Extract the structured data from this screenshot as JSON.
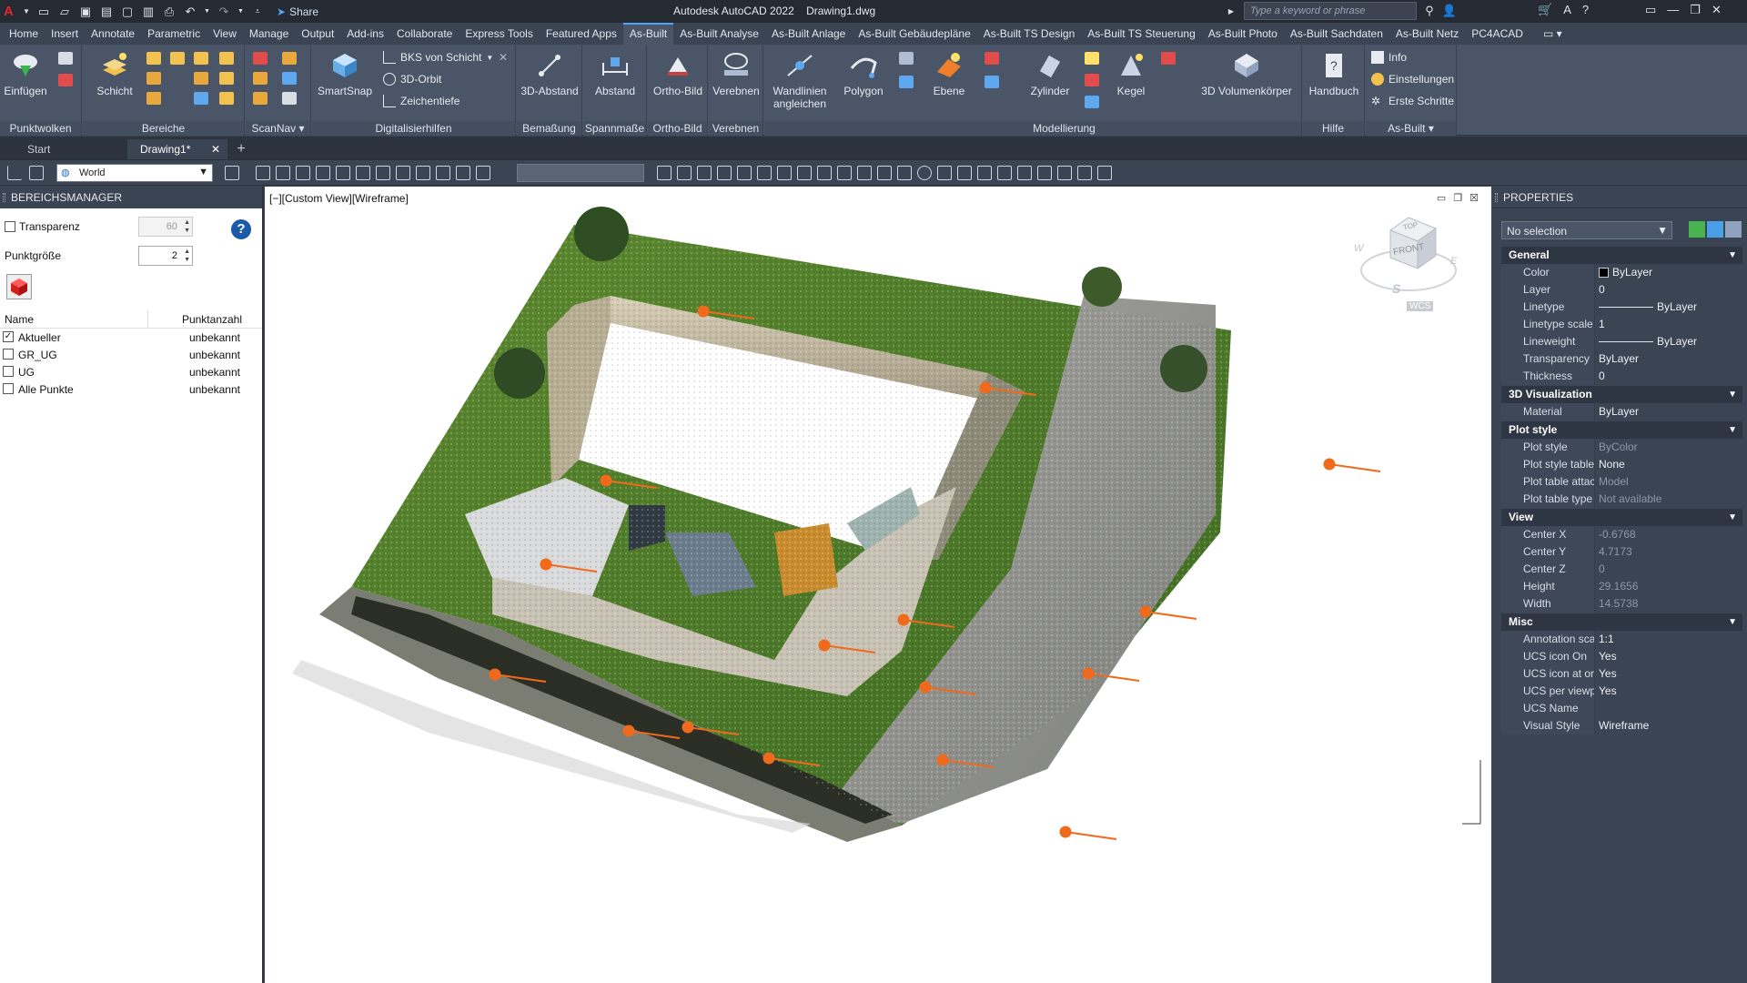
{
  "titlebar": {
    "title": "Autodesk AutoCAD 2022    Drawing1.dwg",
    "share": "Share",
    "search_placeholder": "Type a keyword or phrase"
  },
  "ribbon_tabs": [
    "Home",
    "Insert",
    "Annotate",
    "Parametric",
    "View",
    "Manage",
    "Output",
    "Add-ins",
    "Collaborate",
    "Express Tools",
    "Featured Apps",
    "As-Built",
    "As-Built Analyse",
    "As-Built Anlage",
    "As-Built Gebäudepläne",
    "As-Built TS Design",
    "As-Built TS Steuerung",
    "As-Built Photo",
    "As-Built Sachdaten",
    "As-Built Netz",
    "PC4ACAD"
  ],
  "active_tab": "As-Built",
  "ribbon": {
    "panels": {
      "punktwolken": "Punktwolken",
      "bereiche": "Bereiche",
      "scannav": "ScanNav",
      "digitalisierhilfen": "Digitalisierhilfen",
      "bemassung": "Bemaßung",
      "spannmasse": "Spannmaße",
      "orthobild": "Ortho-Bild",
      "verebnen": "Verebnen",
      "modellierung": "Modellierung",
      "hilfe": "Hilfe",
      "asbuilt": "As-Built"
    },
    "buttons": {
      "einfuegen": "Einfügen",
      "schicht": "Schicht",
      "smartsnap": "SmartSnap",
      "bks_von_schicht": "BKS von Schicht",
      "orbit3d": "3D-Orbit",
      "zeichentiefe": "Zeichentiefe",
      "abstand3d": "3D-Abstand",
      "abstand": "Abstand",
      "orthobild": "Ortho-Bild",
      "verebnen": "Verebnen",
      "wandlinien_1": "Wandlinien",
      "wandlinien_2": "angleichen",
      "polygon": "Polygon",
      "ebene": "Ebene",
      "zylinder": "Zylinder",
      "kegel": "Kegel",
      "volumenkoerper": "3D Volumenkörper",
      "handbuch": "Handbuch",
      "info": "Info",
      "einstellungen": "Einstellungen",
      "erste_schritte": "Erste Schritte"
    }
  },
  "doc_tabs": {
    "start": "Start",
    "active": "Drawing1*"
  },
  "toolbar": {
    "ucs": "World"
  },
  "bereichsmanager": {
    "title": "BEREICHSMANAGER",
    "transparenz_label": "Transparenz",
    "transparenz_value": "60",
    "punktgroesse_label": "Punktgröße",
    "punktgroesse_value": "2",
    "col_name": "Name",
    "col_count": "Punktanzahl",
    "rows": [
      {
        "name": "Aktueller",
        "count": "unbekannt",
        "checked": true
      },
      {
        "name": "GR_UG",
        "count": "unbekannt",
        "checked": false
      },
      {
        "name": "UG",
        "count": "unbekannt",
        "checked": false
      },
      {
        "name": "Alle Punkte",
        "count": "unbekannt",
        "checked": false
      }
    ]
  },
  "viewport": {
    "label": "[−][Custom View][Wireframe]",
    "viewcube": {
      "top": "TOP",
      "front": "FRONT",
      "w": "W",
      "e": "E",
      "s": "S",
      "wcs": "WCS"
    }
  },
  "properties": {
    "title": "PROPERTIES",
    "selection": "No selection",
    "sections": [
      {
        "name": "General",
        "rows": [
          {
            "k": "Color",
            "v": "ByLayer",
            "kind": "color"
          },
          {
            "k": "Layer",
            "v": "0"
          },
          {
            "k": "Linetype",
            "v": "ByLayer",
            "kind": "line"
          },
          {
            "k": "Linetype scale",
            "v": "1"
          },
          {
            "k": "Lineweight",
            "v": "ByLayer",
            "kind": "line"
          },
          {
            "k": "Transparency",
            "v": "ByLayer"
          },
          {
            "k": "Thickness",
            "v": "0"
          }
        ]
      },
      {
        "name": "3D Visualization",
        "rows": [
          {
            "k": "Material",
            "v": "ByLayer"
          }
        ]
      },
      {
        "name": "Plot style",
        "rows": [
          {
            "k": "Plot style",
            "v": "ByColor",
            "ro": true
          },
          {
            "k": "Plot style table",
            "v": "None"
          },
          {
            "k": "Plot table attac...",
            "v": "Model",
            "ro": true
          },
          {
            "k": "Plot table type",
            "v": "Not available",
            "ro": true
          }
        ]
      },
      {
        "name": "View",
        "rows": [
          {
            "k": "Center X",
            "v": "-0.6768",
            "ro": true
          },
          {
            "k": "Center Y",
            "v": "4.7173",
            "ro": true
          },
          {
            "k": "Center Z",
            "v": "0",
            "ro": true
          },
          {
            "k": "Height",
            "v": "29.1656",
            "ro": true
          },
          {
            "k": "Width",
            "v": "14.5738",
            "ro": true
          }
        ]
      },
      {
        "name": "Misc",
        "rows": [
          {
            "k": "Annotation scale",
            "v": "1:1"
          },
          {
            "k": "UCS icon On",
            "v": "Yes"
          },
          {
            "k": "UCS icon at ori...",
            "v": "Yes"
          },
          {
            "k": "UCS per viewport",
            "v": "Yes"
          },
          {
            "k": "UCS Name",
            "v": ""
          },
          {
            "k": "Visual Style",
            "v": "Wireframe"
          }
        ]
      }
    ]
  },
  "colors": {
    "accent": "#4ea3ff",
    "marker": "#f06a1c",
    "panel_bg": "#3b4453",
    "ribbon_bg": "#4a5668"
  }
}
